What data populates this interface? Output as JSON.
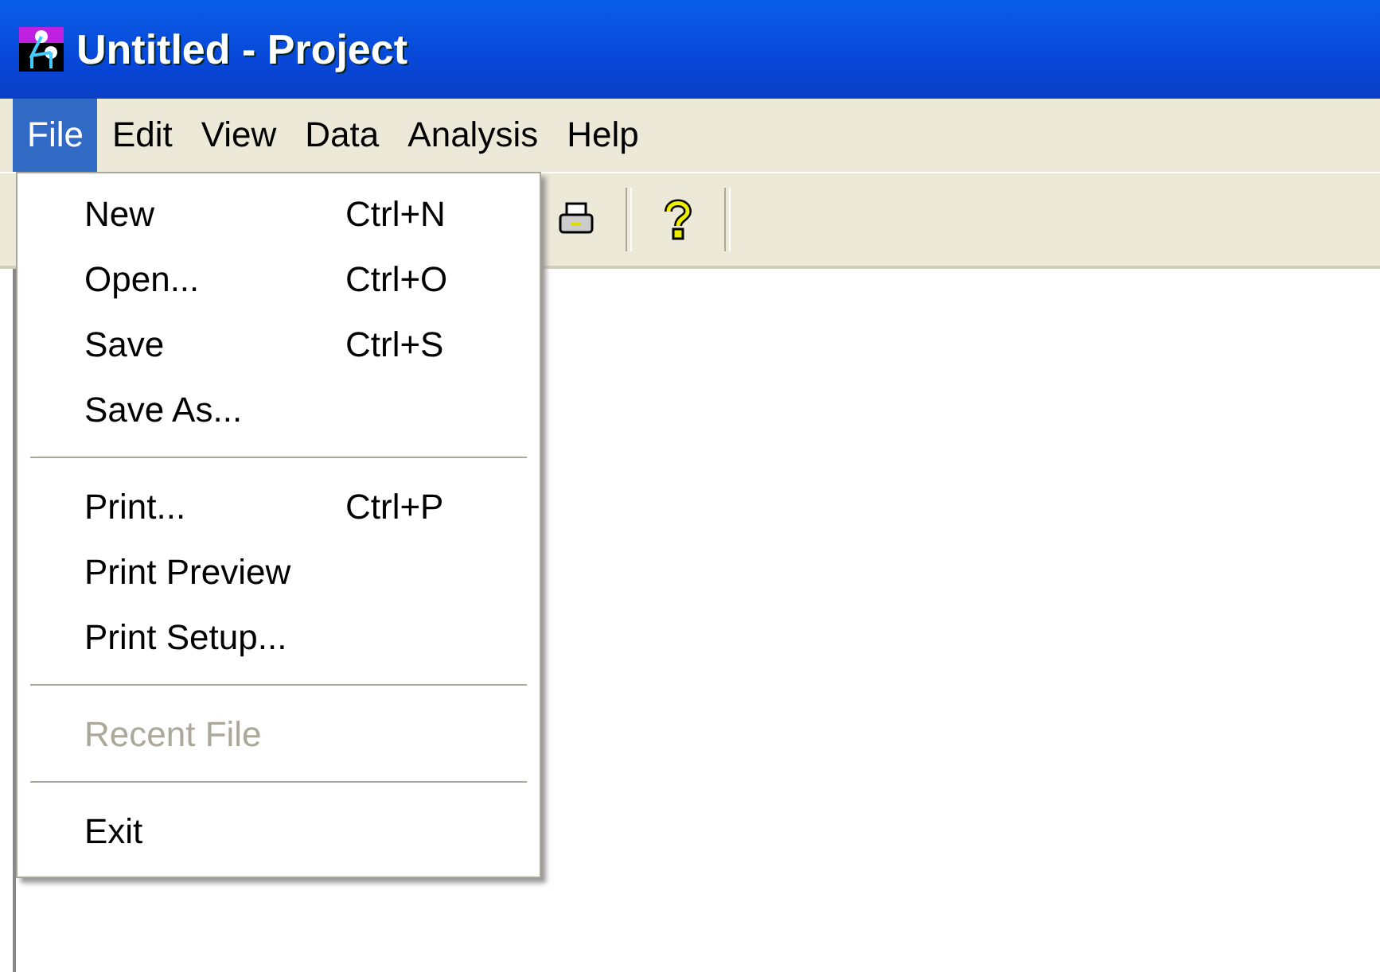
{
  "window": {
    "title": "Untitled - Project"
  },
  "menu_bar": [
    {
      "label": "File",
      "selected": true
    },
    {
      "label": "Edit",
      "selected": false
    },
    {
      "label": "View",
      "selected": false
    },
    {
      "label": "Data",
      "selected": false
    },
    {
      "label": "Analysis",
      "selected": false
    },
    {
      "label": "Help",
      "selected": false
    }
  ],
  "file_menu": [
    {
      "kind": "item",
      "label": "New",
      "shortcut": "Ctrl+N",
      "disabled": false
    },
    {
      "kind": "item",
      "label": "Open...",
      "shortcut": "Ctrl+O",
      "disabled": false
    },
    {
      "kind": "item",
      "label": "Save",
      "shortcut": "Ctrl+S",
      "disabled": false
    },
    {
      "kind": "item",
      "label": "Save As...",
      "disabled": false
    },
    {
      "kind": "separator"
    },
    {
      "kind": "item",
      "label": "Print...",
      "shortcut": "Ctrl+P",
      "disabled": false
    },
    {
      "kind": "item",
      "label": "Print Preview",
      "disabled": false
    },
    {
      "kind": "item",
      "label": "Print Setup...",
      "disabled": false
    },
    {
      "kind": "separator"
    },
    {
      "kind": "item",
      "label": "Recent File",
      "disabled": true
    },
    {
      "kind": "separator"
    },
    {
      "kind": "item",
      "label": "Exit",
      "disabled": false
    }
  ]
}
